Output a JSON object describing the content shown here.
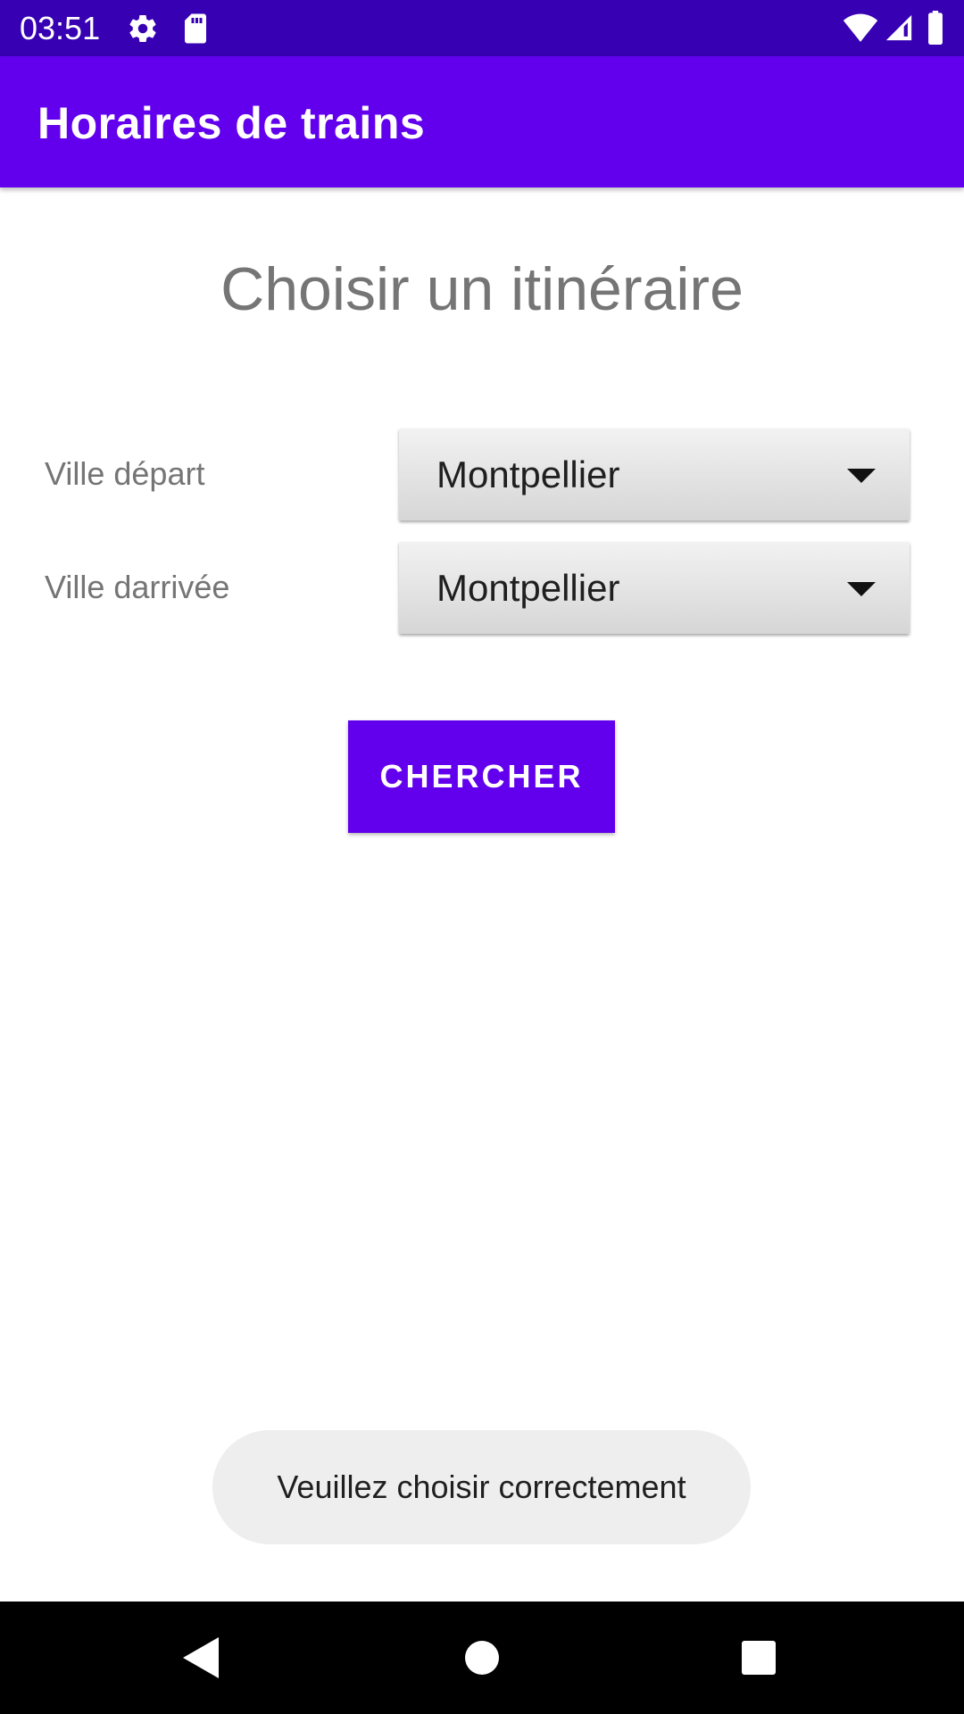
{
  "status_bar": {
    "time": "03:51",
    "icons": [
      "settings-icon",
      "sd-card-icon",
      "wifi-icon",
      "cell-signal-icon",
      "battery-icon"
    ]
  },
  "app_bar": {
    "title": "Horaires de trains",
    "color": "#6200EE"
  },
  "main": {
    "heading": "Choisir un itinéraire",
    "departure": {
      "label": "Ville départ",
      "selected": "Montpellier"
    },
    "arrival": {
      "label": "Ville darrivée",
      "selected": "Montpellier"
    },
    "search_button_label": "CHERCHER"
  },
  "toast": {
    "message": "Veuillez choisir correctement"
  },
  "nav_bar": {
    "buttons": [
      "back-icon",
      "home-icon",
      "recents-icon"
    ]
  }
}
